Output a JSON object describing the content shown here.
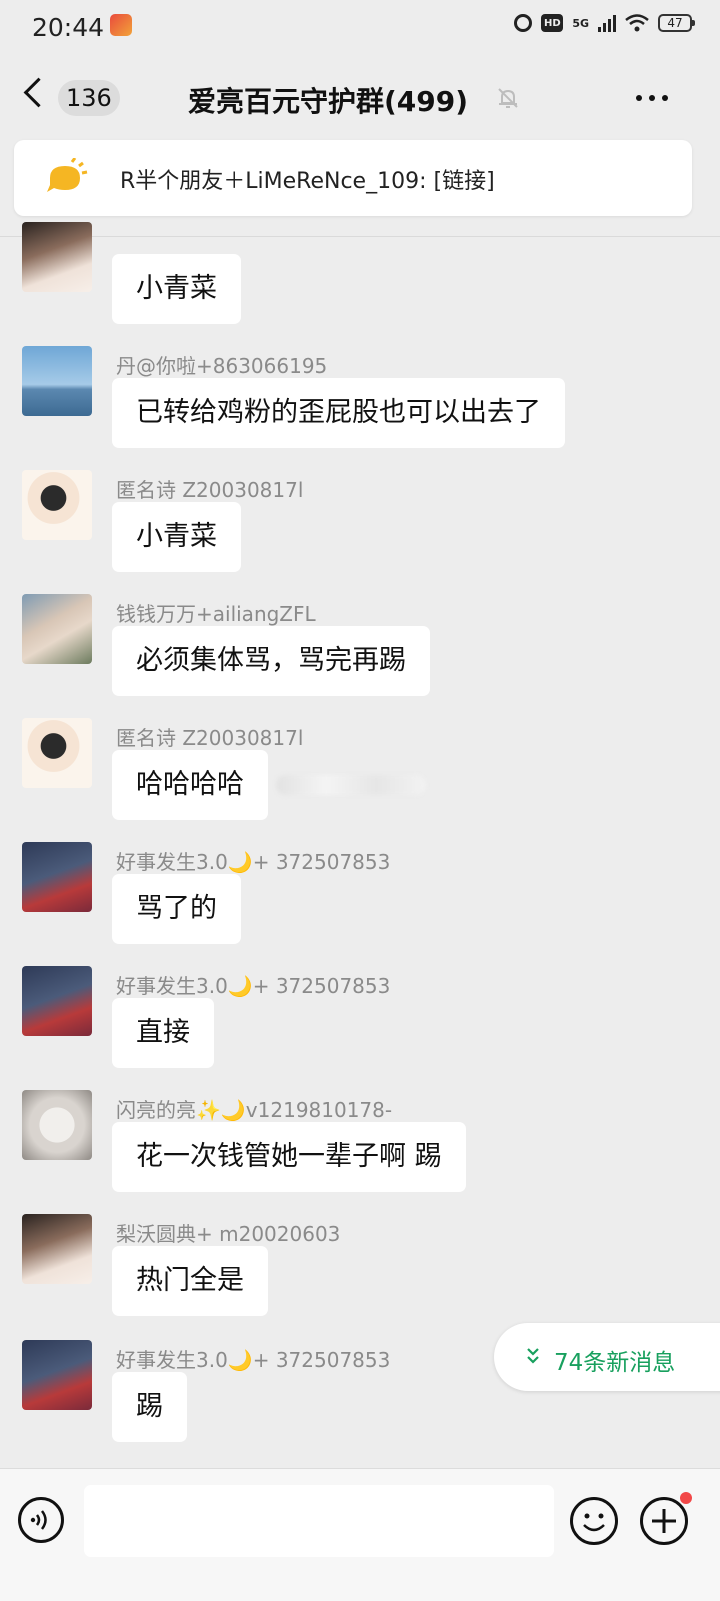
{
  "status_bar": {
    "time": "20:44",
    "network": "5G",
    "hd": "HD",
    "battery": "47"
  },
  "header": {
    "unread_count": "136",
    "title": "爱亮百元守护群(499)"
  },
  "notice": {
    "text": "R半个朋友＋LiMeReNce_109: [链接]"
  },
  "messages": [
    {
      "sender": "",
      "text": "小青菜",
      "avatar": "girl-avatar"
    },
    {
      "sender": "丹@你啦+863066195",
      "text": "已转给鸡粉的歪屁股也可以出去了",
      "avatar": "bridge-avatar"
    },
    {
      "sender": "匿名诗 Z20030817l",
      "text": "小青菜",
      "avatar": "cartoon-girl-avatar"
    },
    {
      "sender": "钱钱万万+ailiangZFL",
      "text": "必须集体骂，骂完再踢",
      "avatar": "sunglasses-avatar"
    },
    {
      "sender": "匿名诗 Z20030817l",
      "text": "哈哈哈哈",
      "avatar": "cartoon-girl-avatar"
    },
    {
      "sender": "好事发生3.0🌙+ 372507853",
      "text": "骂了的",
      "avatar": "mermaid-avatar"
    },
    {
      "sender": "好事发生3.0🌙+ 372507853",
      "text": "直接",
      "avatar": "mermaid-avatar"
    },
    {
      "sender": "闪亮的亮✨🌙v1219810178-",
      "text": "花一次钱管她一辈子啊 踢",
      "avatar": "cat-avatar"
    },
    {
      "sender": "梨沃圆典+ m20020603",
      "text": "热门全是",
      "avatar": "girl-avatar"
    },
    {
      "sender": "好事发生3.0🌙+ 372507853",
      "text": "踢",
      "avatar": "mermaid-avatar"
    }
  ],
  "new_messages": {
    "text": "74条新消息"
  },
  "colors": {
    "accent_green": "#18a05e",
    "bubble": "#ffffff",
    "background": "#ededed"
  }
}
